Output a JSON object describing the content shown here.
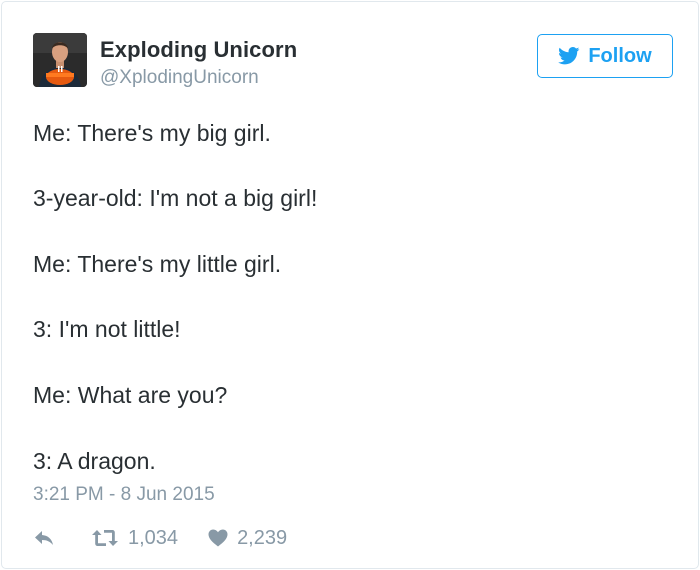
{
  "author": {
    "display_name": "Exploding Unicorn",
    "handle": "@XplodingUnicorn"
  },
  "follow_button": {
    "label": "Follow",
    "icon": "twitter-bird-icon"
  },
  "tweet": {
    "lines": [
      "Me: There's my big girl.",
      "3-year-old: I'm not a big girl!",
      "Me: There's my little girl.",
      "3: I'm not little!",
      "Me: What are you?",
      "3: A dragon."
    ],
    "timestamp": "3:21 PM - 8 Jun 2015"
  },
  "actions": {
    "reply": {
      "icon": "reply-icon"
    },
    "retweet": {
      "icon": "retweet-icon",
      "count": "1,034"
    },
    "like": {
      "icon": "heart-icon",
      "count": "2,239"
    }
  },
  "colors": {
    "text": "#292f33",
    "muted": "#8899a6",
    "accent": "#1da1f2",
    "border": "#e1e8ed"
  }
}
